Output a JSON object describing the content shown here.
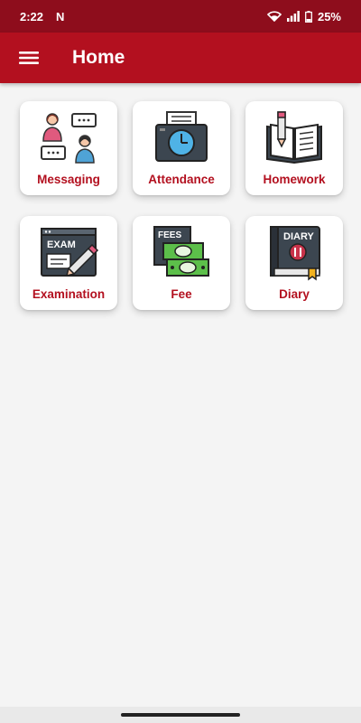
{
  "status_bar": {
    "time": "2:22",
    "notification": "N",
    "battery": "25%"
  },
  "app_bar": {
    "title": "Home"
  },
  "tiles": [
    {
      "label": "Messaging",
      "icon": "messaging-icon"
    },
    {
      "label": "Attendance",
      "icon": "attendance-icon"
    },
    {
      "label": "Homework",
      "icon": "homework-icon"
    },
    {
      "label": "Examination",
      "icon": "examination-icon"
    },
    {
      "label": "Fee",
      "icon": "fee-icon"
    },
    {
      "label": "Diary",
      "icon": "diary-icon"
    }
  ],
  "icon_text": {
    "exam": "EXAM",
    "fees": "FEES",
    "diary": "DIARY"
  },
  "colors": {
    "status_bar": "#8e0d1c",
    "app_bar": "#b3101f",
    "accent_text": "#b3101f",
    "background": "#f4f4f4"
  }
}
